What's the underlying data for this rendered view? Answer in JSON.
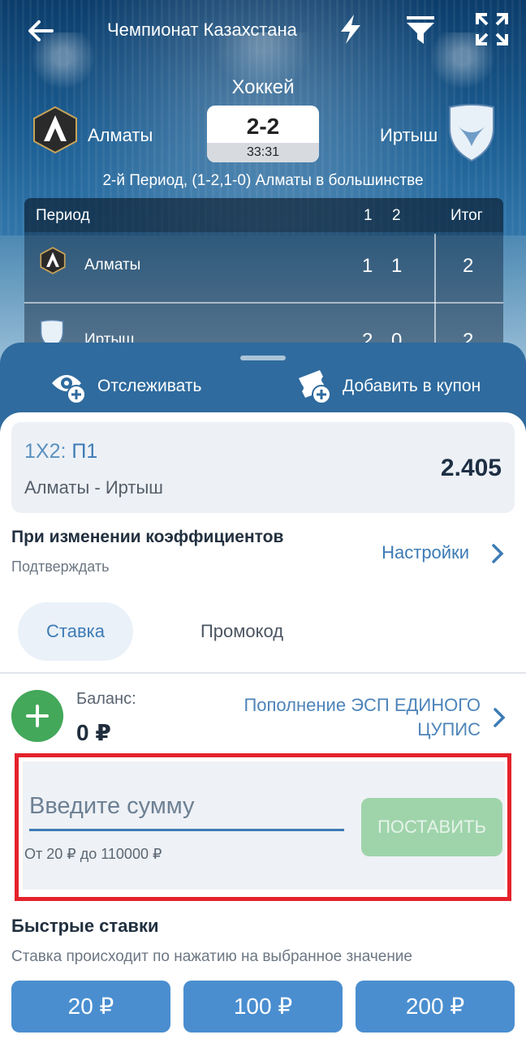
{
  "header": {
    "title": "Чемпионат Казахстана",
    "sport": "Хоккей"
  },
  "match": {
    "home": "Алматы",
    "away": "Иртыш",
    "score": "2-2",
    "time": "33:31",
    "period_info": "2-й Период, (1-2,1-0) Алматы в большинстве"
  },
  "periods_table": {
    "header": {
      "label": "Период",
      "p1": "1",
      "p2": "2",
      "total": "Итог"
    },
    "rows": [
      {
        "team": "Алматы",
        "p1": "1",
        "p2": "1",
        "total": "2"
      },
      {
        "team": "Иртыш",
        "p1": "2",
        "p2": "0",
        "total": "2"
      }
    ]
  },
  "actions": {
    "track": "Отслеживать",
    "add_coupon": "Добавить в купон"
  },
  "coupon": {
    "market_prefix": "1X2: ",
    "market_value": "П1",
    "match": "Алматы - Иртыш",
    "odds": "2.405"
  },
  "odds_change": {
    "title": "При изменении коэффициентов",
    "value": "Подтверждать",
    "settings_link": "Настройки"
  },
  "tabs": {
    "stake": "Ставка",
    "promo": "Промокод"
  },
  "balance": {
    "label": "Баланс:",
    "value": "0 ₽",
    "topup_link": "Пополнение ЭСП ЕДИНОГО ЦУПИС"
  },
  "stake_form": {
    "placeholder": "Введите сумму",
    "limits": "От 20 ₽ до 110000 ₽",
    "place_button": "ПОСТАВИТЬ"
  },
  "quick_bets": {
    "title": "Быстрые ставки",
    "subtitle": "Ставка происходит по нажатию на выбранное значение",
    "values": [
      "20 ₽",
      "100 ₽",
      "200 ₽"
    ]
  },
  "colors": {
    "accent": "#3d7bb5",
    "sheet": "#2f6b9e",
    "success": "#43a85a",
    "highlight": "#e3222b"
  }
}
